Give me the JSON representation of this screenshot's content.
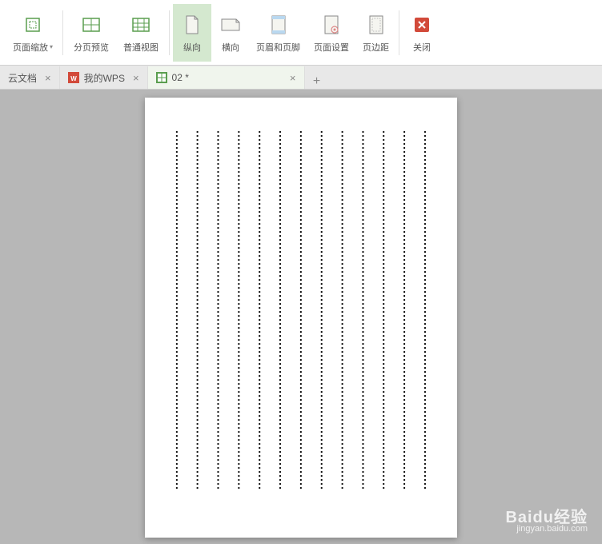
{
  "ribbon": {
    "zoom": "页面缩放",
    "page_preview": "分页预览",
    "normal_view": "普通视图",
    "portrait": "纵向",
    "landscape": "横向",
    "header_footer": "页眉和页脚",
    "page_setup": "页面设置",
    "margins": "页边距",
    "close": "关闭"
  },
  "tabs": {
    "t1": "云文档",
    "t2": "我的WPS",
    "t3": "02 *"
  },
  "watermark": {
    "brand": "Baidu经验",
    "url": "jingyan.baidu.com"
  },
  "doc": {
    "cols": 13,
    "rows": 90
  }
}
